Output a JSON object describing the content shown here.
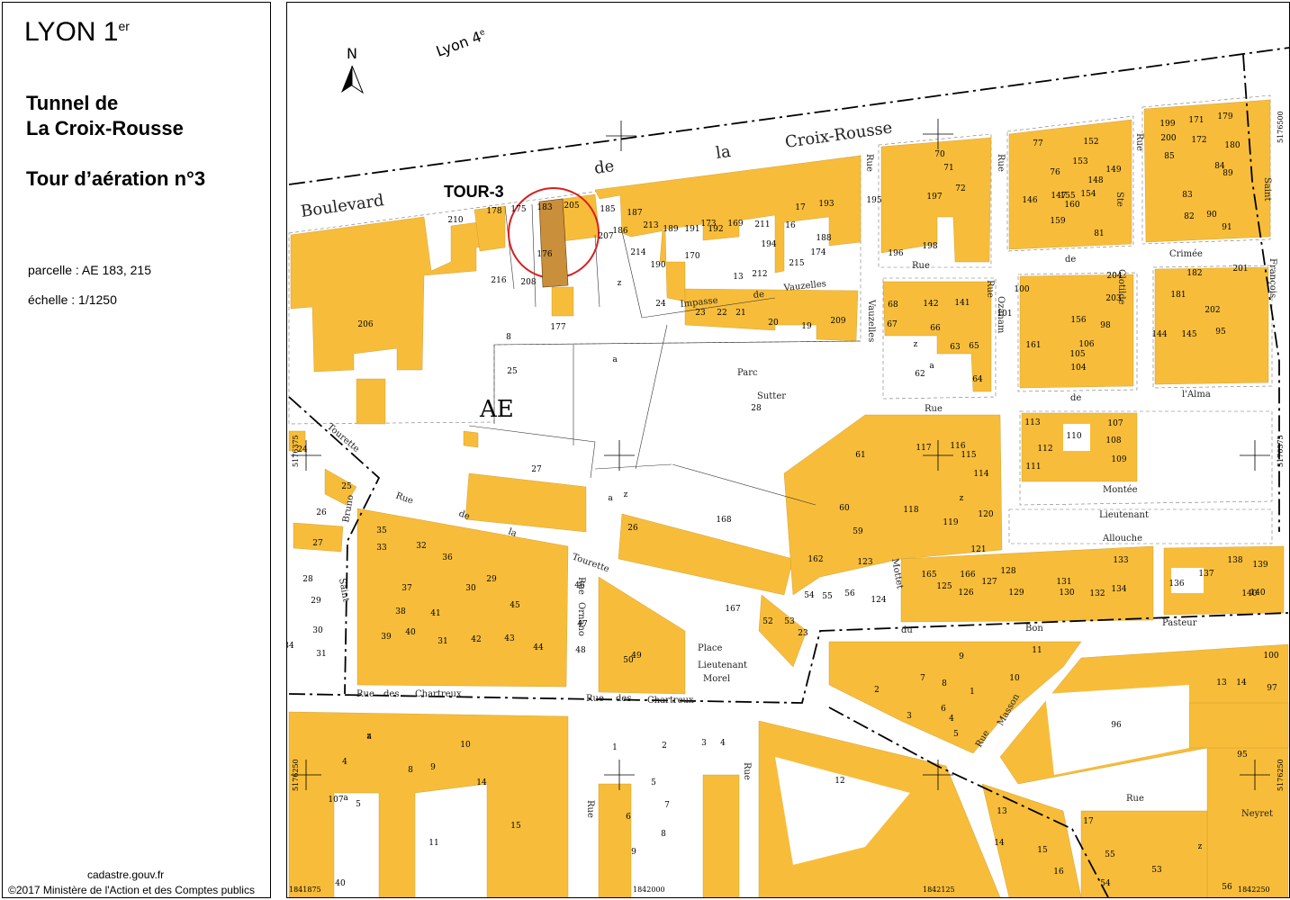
{
  "legend": {
    "city": "LYON 1",
    "city_sup": "er",
    "title_line1": "Tunnel de",
    "title_line2": "La Croix-Rousse",
    "subtitle": "Tour d’aération n°3",
    "parcelle": "parcelle : AE 183, 215",
    "echelle": "échelle : 1/1250",
    "source": "cadastre.gouv.fr",
    "copyright": "©2017 Ministère de l'Action et des Comptes publics"
  },
  "map": {
    "north": "N",
    "district_label": "Lyon 4",
    "district_sup": "e",
    "tower_label": "TOUR-3",
    "section_label": "AE",
    "highlight_color": "#c98f3a",
    "building_color": "#f7bd3a",
    "circle_color": "#d42020",
    "streets": [
      {
        "id": "s1",
        "text": "Boulevard"
      },
      {
        "id": "s2",
        "text": "de"
      },
      {
        "id": "s3",
        "text": "la"
      },
      {
        "id": "s4",
        "text": "Croix-Rousse"
      },
      {
        "id": "s5",
        "text": "Impasse"
      },
      {
        "id": "s6",
        "text": "de"
      },
      {
        "id": "s7",
        "text": "Vauzelles"
      },
      {
        "id": "s8",
        "text": "Rue"
      },
      {
        "id": "s9",
        "text": "de"
      },
      {
        "id": "s10",
        "text": "la"
      },
      {
        "id": "s11",
        "text": "Tourette"
      },
      {
        "id": "s12",
        "text": "Tourette"
      },
      {
        "id": "s13",
        "text": "Rue"
      },
      {
        "id": "s14",
        "text": "des"
      },
      {
        "id": "s15",
        "text": "Chartreux"
      },
      {
        "id": "s16",
        "text": "Rue"
      },
      {
        "id": "s17",
        "text": "des"
      },
      {
        "id": "s18",
        "text": "Chartreux"
      },
      {
        "id": "s19",
        "text": "Rue"
      },
      {
        "id": "s20",
        "text": "de"
      },
      {
        "id": "s21",
        "text": "Rue"
      },
      {
        "id": "s22",
        "text": "Vauzelles"
      },
      {
        "id": "s23",
        "text": "Rue"
      },
      {
        "id": "s24",
        "text": "Ozanam"
      },
      {
        "id": "s25",
        "text": "Rue"
      },
      {
        "id": "s26",
        "text": "Crimée"
      },
      {
        "id": "s27",
        "text": "de"
      },
      {
        "id": "s28",
        "text": "de"
      },
      {
        "id": "s29",
        "text": "l'Alma"
      },
      {
        "id": "s30",
        "text": "Montée"
      },
      {
        "id": "s31",
        "text": "Lieutenant"
      },
      {
        "id": "s32",
        "text": "Allouche"
      },
      {
        "id": "s33",
        "text": "du"
      },
      {
        "id": "s34",
        "text": "Bon"
      },
      {
        "id": "s35",
        "text": "Pasteur"
      },
      {
        "id": "s36",
        "text": "Rue"
      },
      {
        "id": "s37",
        "text": "Ornano"
      },
      {
        "id": "s38",
        "text": "Place"
      },
      {
        "id": "s39",
        "text": "Lieutenant"
      },
      {
        "id": "s40",
        "text": "Morel"
      },
      {
        "id": "s41",
        "text": "Parc"
      },
      {
        "id": "s42",
        "text": "Sutter"
      },
      {
        "id": "s43",
        "text": "Rue"
      },
      {
        "id": "s44",
        "text": "Neyret"
      },
      {
        "id": "s45",
        "text": "Rue"
      },
      {
        "id": "s46",
        "text": "Masson"
      },
      {
        "id": "s47",
        "text": "Saint"
      },
      {
        "id": "s48",
        "text": "Bruno"
      },
      {
        "id": "s49",
        "text": "Rue"
      },
      {
        "id": "s50",
        "text": "Rue"
      },
      {
        "id": "s51",
        "text": "Rue"
      },
      {
        "id": "s52",
        "text": "Ste"
      },
      {
        "id": "s53",
        "text": "Clotilde"
      },
      {
        "id": "s54",
        "text": "Rue"
      },
      {
        "id": "s55",
        "text": "Saint"
      },
      {
        "id": "s56",
        "text": "François"
      },
      {
        "id": "s57",
        "text": "Mottet"
      }
    ],
    "parcels": [
      "210",
      "178",
      "175",
      "183",
      "205",
      "185",
      "187",
      "186",
      "207",
      "213",
      "189",
      "191",
      "192",
      "173",
      "169",
      "211",
      "16",
      "17",
      "193",
      "188",
      "214",
      "190",
      "170",
      "194",
      "174",
      "13",
      "212",
      "215",
      "176",
      "208",
      "z",
      "216",
      "177",
      "8",
      "24",
      "23",
      "22",
      "21",
      "20",
      "19",
      "209",
      "206",
      "a",
      "25",
      "28",
      "27",
      "a",
      "z",
      "26",
      "168",
      "167",
      "52",
      "53",
      "23",
      "24",
      "25",
      "26",
      "27",
      "28",
      "29",
      "30",
      "31",
      "34",
      "35",
      "33",
      "32",
      "36",
      "37",
      "38",
      "39",
      "40",
      "41",
      "31",
      "30",
      "29",
      "45",
      "42",
      "43",
      "44",
      "46",
      "47",
      "48",
      "50",
      "49",
      "195",
      "70",
      "71",
      "72",
      "197",
      "196",
      "198",
      "77",
      "152",
      "76",
      "153",
      "149",
      "148",
      "146",
      "147",
      "155",
      "154",
      "160",
      "159",
      "81",
      "199",
      "171",
      "179",
      "200",
      "172",
      "180",
      "85",
      "84",
      "89",
      "83",
      "82",
      "90",
      "91",
      "68",
      "142",
      "141",
      "67",
      "66",
      "z",
      "63",
      "65",
      "62",
      "64",
      "a",
      "100",
      "204",
      "203",
      "101",
      "156",
      "98",
      "161",
      "106",
      "105",
      "104",
      "182",
      "201",
      "181",
      "202",
      "144",
      "145",
      "95",
      "113",
      "107",
      "140",
      "112",
      "110",
      "108",
      "111",
      "109",
      "61",
      "117",
      "116",
      "115",
      "114",
      "60",
      "118",
      "z",
      "119",
      "120",
      "59",
      "121",
      "162",
      "123",
      "54",
      "55",
      "56",
      "124",
      "165",
      "166",
      "125",
      "126",
      "127",
      "128",
      "129",
      "131",
      "130",
      "132",
      "133",
      "134",
      "136",
      "137",
      "138",
      "139",
      "140",
      "11",
      "9",
      "7",
      "8",
      "2",
      "1",
      "6",
      "3",
      "4",
      "5",
      "10",
      "13",
      "14",
      "96",
      "100",
      "97",
      "95",
      "z",
      "4",
      "5",
      "a",
      "8",
      "9",
      "10",
      "14",
      "15",
      "11",
      "40",
      "1",
      "2",
      "3",
      "4",
      "5",
      "7",
      "6",
      "8",
      "9",
      "12",
      "13",
      "14",
      "15",
      "16",
      "17",
      "55",
      "54",
      "53",
      "56",
      "107",
      "a",
      "z",
      "1"
    ],
    "coords": [
      "5176375",
      "5176375",
      "5176500",
      "5176250",
      "5176250",
      "1841875",
      "1842000",
      "1842125",
      "1842250"
    ]
  }
}
